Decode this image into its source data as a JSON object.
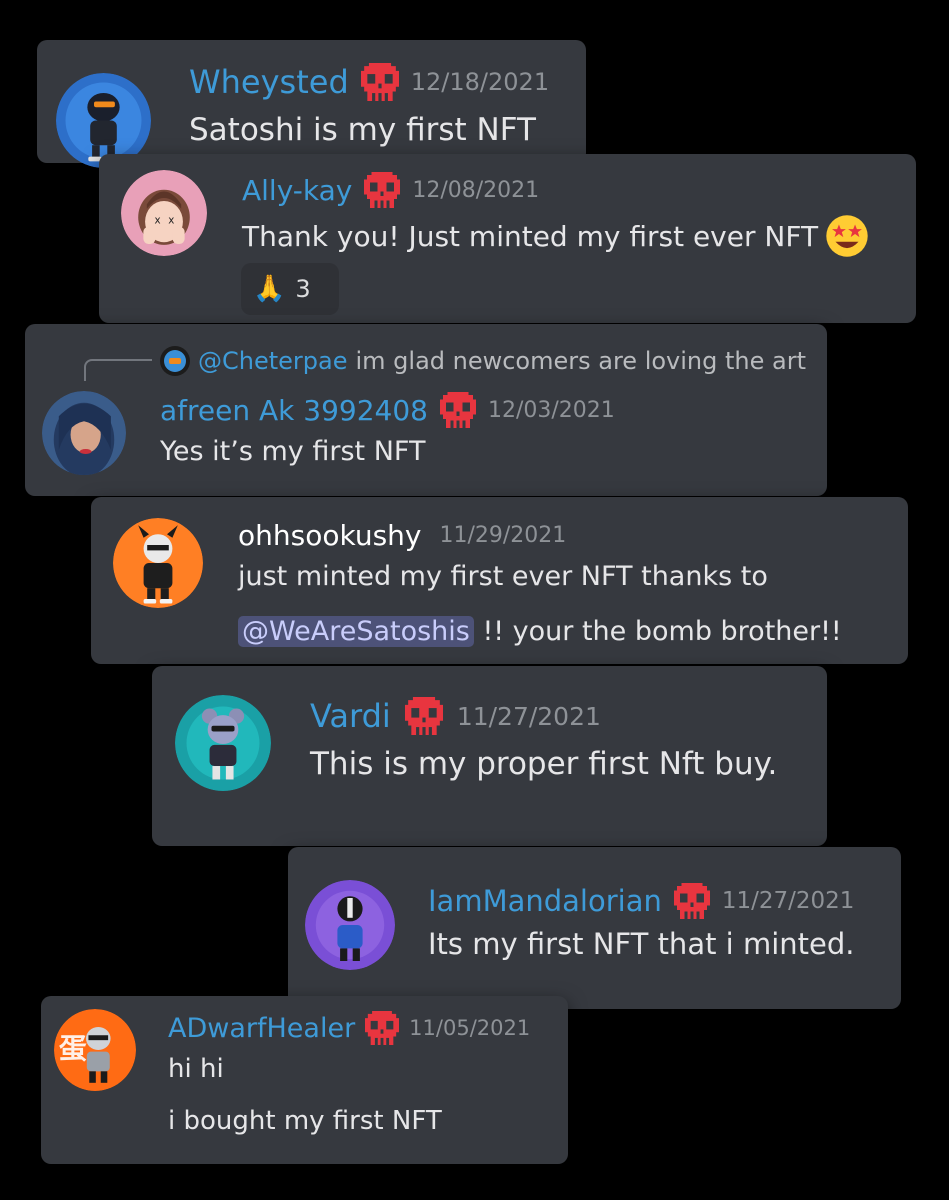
{
  "messages": [
    {
      "username": "Wheysted",
      "date": "12/18/2021",
      "text": "Satoshi is my first NFT"
    },
    {
      "username": "Ally-kay",
      "date": "12/08/2021",
      "text": "Thank you! Just minted my first ever NFT",
      "reaction": {
        "emoji": "🙏",
        "count": "3"
      }
    },
    {
      "reply": {
        "author": "@Cheterpae",
        "text": "im glad newcomers are loving the art"
      },
      "username": "afreen Ak 3992408",
      "date": "12/03/2021",
      "text": "Yes it’s my first NFT"
    },
    {
      "username": "ohhsookushy",
      "date": "11/29/2021",
      "text1": "just minted my first ever NFT thanks to",
      "mention": "@WeAreSatoshis",
      "text2": " !! your the bomb brother!!"
    },
    {
      "username": "Vardi",
      "date": "11/27/2021",
      "text": "This is my proper first Nft buy."
    },
    {
      "username": "IamMandalorian",
      "date": "11/27/2021",
      "text": "Its my first NFT that i minted."
    },
    {
      "username": "ADwarfHealer",
      "date": "11/05/2021",
      "text": "hi hi",
      "text2": "i bought my first NFT"
    }
  ],
  "colors": {
    "card": "#36393f",
    "username_blue": "#3e9bd8",
    "timestamp": "#8e9297",
    "skull": "#ed4245",
    "mention_bg": "#4d5278"
  }
}
